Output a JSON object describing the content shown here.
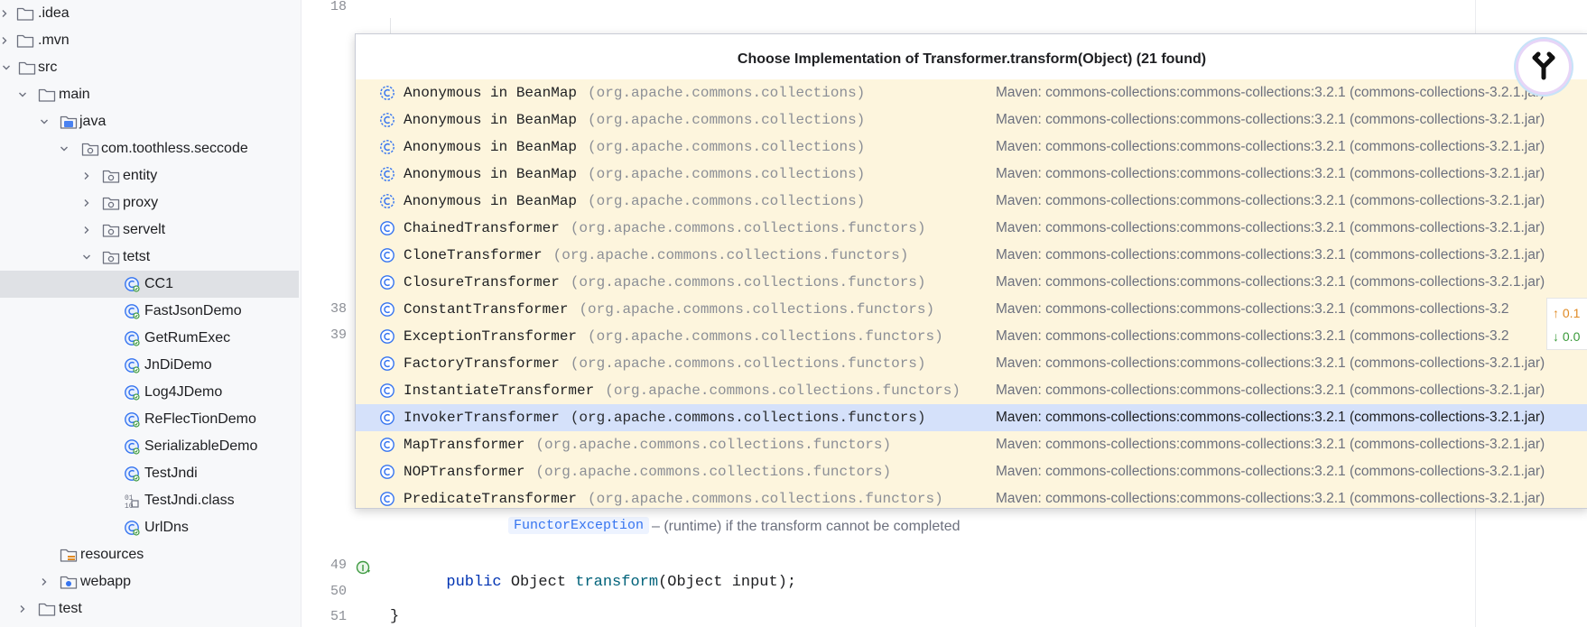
{
  "project_tree": {
    "items": [
      {
        "label": ".idea",
        "icon": "folder-icon",
        "expand": "collapsed"
      },
      {
        "label": ".mvn",
        "icon": "folder-icon",
        "expand": "collapsed"
      },
      {
        "label": "src",
        "icon": "folder-icon",
        "expand": "expanded"
      },
      {
        "label": "main",
        "icon": "folder-icon",
        "expand": "expanded"
      },
      {
        "label": "java",
        "icon": "source-folder-icon",
        "expand": "expanded"
      },
      {
        "label": "com.toothless.seccode",
        "icon": "package-icon",
        "expand": "expanded"
      },
      {
        "label": "entity",
        "icon": "package-icon",
        "expand": "collapsed"
      },
      {
        "label": "proxy",
        "icon": "package-icon",
        "expand": "collapsed"
      },
      {
        "label": "servelt",
        "icon": "package-icon",
        "expand": "collapsed"
      },
      {
        "label": "tetst",
        "icon": "package-icon",
        "expand": "expanded"
      },
      {
        "label": "CC1",
        "icon": "java-class-icon",
        "selected": true
      },
      {
        "label": "FastJsonDemo",
        "icon": "java-class-icon"
      },
      {
        "label": "GetRumExec",
        "icon": "java-class-icon"
      },
      {
        "label": "JnDiDemo",
        "icon": "java-class-icon"
      },
      {
        "label": "Log4JDemo",
        "icon": "java-class-icon"
      },
      {
        "label": "ReFlecTionDemo",
        "icon": "java-class-icon"
      },
      {
        "label": "SerializableDemo",
        "icon": "java-class-icon"
      },
      {
        "label": "TestJndi",
        "icon": "java-class-icon"
      },
      {
        "label": "TestJndi.class",
        "icon": "binary-class-icon"
      },
      {
        "label": "UrlDns",
        "icon": "java-class-icon"
      },
      {
        "label": "resources",
        "icon": "resources-folder-icon"
      },
      {
        "label": "webapp",
        "icon": "web-folder-icon",
        "expand": "collapsed"
      },
      {
        "label": "test",
        "icon": "folder-icon",
        "expand": "collapsed"
      }
    ]
  },
  "editor": {
    "gutter": {
      "line_18": "18",
      "line_38": "38",
      "line_39": "39",
      "line_49": "49",
      "line_50": "50",
      "line_51": "51"
    },
    "doc_exception_tag": "FunctorException",
    "doc_exception_text": "– (runtime) if the transform cannot be completed",
    "code_line_49": {
      "kw": "public",
      "type": " Object ",
      "method": "transform",
      "rest": "(Object input);"
    },
    "code_line_51": "}",
    "stats": {
      "up": "↑ 0.1",
      "down": "↓ 0.0"
    }
  },
  "popup": {
    "title": "Choose Implementation of Transformer.transform(Object) (21 found)",
    "items": [
      {
        "name": "Anonymous in BeanMap",
        "pkg": "(org.apache.commons.collections)",
        "loc": "Maven: commons-collections:commons-collections:3.2.1 (commons-collections-3.2.1.jar)",
        "icon": "anonymous-class-icon"
      },
      {
        "name": "Anonymous in BeanMap",
        "pkg": "(org.apache.commons.collections)",
        "loc": "Maven: commons-collections:commons-collections:3.2.1 (commons-collections-3.2.1.jar)",
        "icon": "anonymous-class-icon"
      },
      {
        "name": "Anonymous in BeanMap",
        "pkg": "(org.apache.commons.collections)",
        "loc": "Maven: commons-collections:commons-collections:3.2.1 (commons-collections-3.2.1.jar)",
        "icon": "anonymous-class-icon"
      },
      {
        "name": "Anonymous in BeanMap",
        "pkg": "(org.apache.commons.collections)",
        "loc": "Maven: commons-collections:commons-collections:3.2.1 (commons-collections-3.2.1.jar)",
        "icon": "anonymous-class-icon"
      },
      {
        "name": "Anonymous in BeanMap",
        "pkg": "(org.apache.commons.collections)",
        "loc": "Maven: commons-collections:commons-collections:3.2.1 (commons-collections-3.2.1.jar)",
        "icon": "anonymous-class-icon"
      },
      {
        "name": "ChainedTransformer",
        "pkg": "(org.apache.commons.collections.functors)",
        "loc": "Maven: commons-collections:commons-collections:3.2.1 (commons-collections-3.2.1.jar)",
        "icon": "class-icon"
      },
      {
        "name": "CloneTransformer",
        "pkg": "(org.apache.commons.collections.functors)",
        "loc": "Maven: commons-collections:commons-collections:3.2.1 (commons-collections-3.2.1.jar)",
        "icon": "class-icon"
      },
      {
        "name": "ClosureTransformer",
        "pkg": "(org.apache.commons.collections.functors)",
        "loc": "Maven: commons-collections:commons-collections:3.2.1 (commons-collections-3.2.1.jar)",
        "icon": "class-icon"
      },
      {
        "name": "ConstantTransformer",
        "pkg": "(org.apache.commons.collections.functors)",
        "loc": "Maven: commons-collections:commons-collections:3.2.1 (commons-collections-3.2",
        "icon": "class-icon"
      },
      {
        "name": "ExceptionTransformer",
        "pkg": "(org.apache.commons.collections.functors)",
        "loc": "Maven: commons-collections:commons-collections:3.2.1 (commons-collections-3.2",
        "icon": "class-icon"
      },
      {
        "name": "FactoryTransformer",
        "pkg": "(org.apache.commons.collections.functors)",
        "loc": "Maven: commons-collections:commons-collections:3.2.1 (commons-collections-3.2.1.jar)",
        "icon": "class-icon"
      },
      {
        "name": "InstantiateTransformer",
        "pkg": "(org.apache.commons.collections.functors)",
        "loc": "Maven: commons-collections:commons-collections:3.2.1 (commons-collections-3.2.1.jar)",
        "icon": "class-icon"
      },
      {
        "name": "InvokerTransformer",
        "pkg": "(org.apache.commons.collections.functors)",
        "loc": "Maven: commons-collections:commons-collections:3.2.1 (commons-collections-3.2.1.jar)",
        "icon": "class-icon",
        "selected": true
      },
      {
        "name": "MapTransformer",
        "pkg": "(org.apache.commons.collections.functors)",
        "loc": "Maven: commons-collections:commons-collections:3.2.1 (commons-collections-3.2.1.jar)",
        "icon": "class-icon"
      },
      {
        "name": "NOPTransformer",
        "pkg": "(org.apache.commons.collections.functors)",
        "loc": "Maven: commons-collections:commons-collections:3.2.1 (commons-collections-3.2.1.jar)",
        "icon": "class-icon"
      },
      {
        "name": "PredicateTransformer",
        "pkg": "(org.apache.commons.collections.functors)",
        "loc": "Maven: commons-collections:commons-collections:3.2.1 (commons-collections-3.2.1.jar)",
        "icon": "class-icon"
      }
    ]
  },
  "colors": {
    "popup_row_bg": "#fdf5dd",
    "popup_selected_bg": "#d5e1fa",
    "class_icon": "#3574f0",
    "tree_selected_bg": "#dfe1e5"
  }
}
